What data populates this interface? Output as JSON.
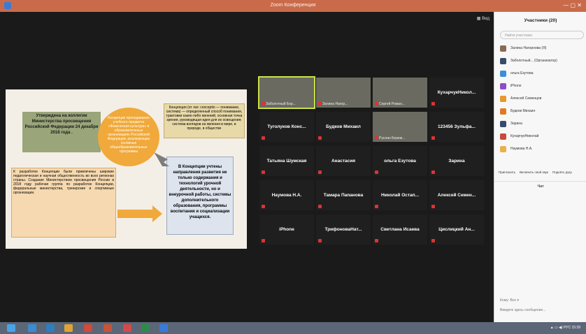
{
  "window": {
    "title": "Zoom Конференция",
    "right_label": "Вид"
  },
  "slide": {
    "box_approved": "Утверждена на коллегии Министерства просвещения Российской Федерации 24 декабря 2018 года .",
    "box_concept_title": "Концепция преподавания учебного предмета «Физическая культура» в образовательных организациях Российской Федерации, реализующих основные общеобразовательные программы",
    "box_definition": "Концепция (от лат. conceptio — понимание, система) — определенный способ понимания, трактовки каких-либо явлений, основная точка зрения, руководящая идея для их освещения; система взглядов на явления в мире, в природе, в обществе",
    "box_development": "К разработке Концепции были привлечены широкие педагогическая и научная общественность во всех регионах страны. Создание Министерством просвещения России в 2018 году рабочая группа по разработке Концепции, федеральные министерства, тренерские и спортивные организации.",
    "box_directions": "В Концепции учтены направления развития не только содержания и технологий урочной деятельности, но и внеурочной работы, системы дополнительного образования, программы воспитания и социализации учащихся."
  },
  "tiles": [
    {
      "label": "Заболотный Бор...",
      "type": "video",
      "speaking": true
    },
    {
      "label": "Залина Нагор...",
      "type": "video"
    },
    {
      "label": "Сергей Роман...",
      "type": "video"
    },
    {
      "label": "КухарчукНикол...",
      "type": "name"
    },
    {
      "label": "Туголуков Конс...",
      "type": "name"
    },
    {
      "label": "Будков Михаил",
      "type": "name"
    },
    {
      "label": "Руслан Береж...",
      "type": "video"
    },
    {
      "label": "123456 Зульфа...",
      "type": "name"
    },
    {
      "label": "Татьяна Шумская",
      "type": "name"
    },
    {
      "label": "Анастасия",
      "type": "name"
    },
    {
      "label": "ольга Езутова",
      "type": "name"
    },
    {
      "label": "Зарина",
      "type": "name"
    },
    {
      "label": "Наумова Н.А.",
      "type": "name"
    },
    {
      "label": "Тамара Папанова",
      "type": "name"
    },
    {
      "label": "Николай Остап...",
      "type": "name"
    },
    {
      "label": "Алексей Семен...",
      "type": "name"
    },
    {
      "label": "iPhone",
      "type": "name"
    },
    {
      "label": "ТрифоноваНат...",
      "type": "name"
    },
    {
      "label": "Светлана Исаева",
      "type": "name"
    },
    {
      "label": "Цислицкий Ан...",
      "type": "name"
    }
  ],
  "participants": {
    "header": "Участники (20)",
    "search_placeholder": "Найти участника",
    "list": [
      {
        "name": "Залина Нагорнова (Я)",
        "color": "#8a6a54"
      },
      {
        "name": "Заболотный... (Организатор)",
        "color": "#3a4a6a"
      },
      {
        "name": "ольга Езутова",
        "color": "#3a8fd6"
      },
      {
        "name": "iPhone",
        "color": "#8c4fc4"
      },
      {
        "name": "Алексей Семенцов",
        "color": "#e69a2a"
      },
      {
        "name": "Будков Михаил",
        "color": "#e07a22"
      },
      {
        "name": "Зарина",
        "color": "#3a4a6a"
      },
      {
        "name": "КухарчукНиколай",
        "color": "#c94a3a"
      },
      {
        "name": "Наумова Н.А.",
        "color": "#e8b24a"
      }
    ],
    "buttons": [
      "Пригласить",
      "Включить свой звук",
      "Поднять руку"
    ]
  },
  "chat": {
    "header": "Чат",
    "to_label": "Кому:",
    "to_value": "Все",
    "input_placeholder": "Введите здесь сообщение..."
  },
  "taskbar": {
    "lang": "РУС",
    "time": "15:39"
  }
}
